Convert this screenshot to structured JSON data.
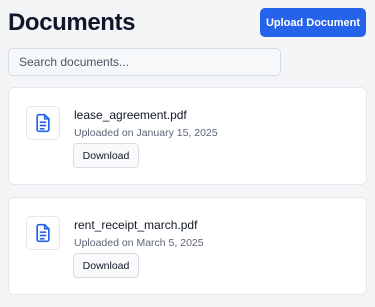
{
  "page": {
    "title": "Documents",
    "upload_label": "Upload Document"
  },
  "search": {
    "placeholder": "Search documents...",
    "value": ""
  },
  "documents": [
    {
      "name": "lease_agreement.pdf",
      "uploaded": "Uploaded on January 15, 2025",
      "download_label": "Download",
      "icon": "file-text-icon"
    },
    {
      "name": "rent_receipt_march.pdf",
      "uploaded": "Uploaded on March 5, 2025",
      "download_label": "Download",
      "icon": "file-text-icon"
    }
  ],
  "colors": {
    "accent": "#2563eb",
    "background": "#f4f5f7",
    "card": "#ffffff"
  }
}
